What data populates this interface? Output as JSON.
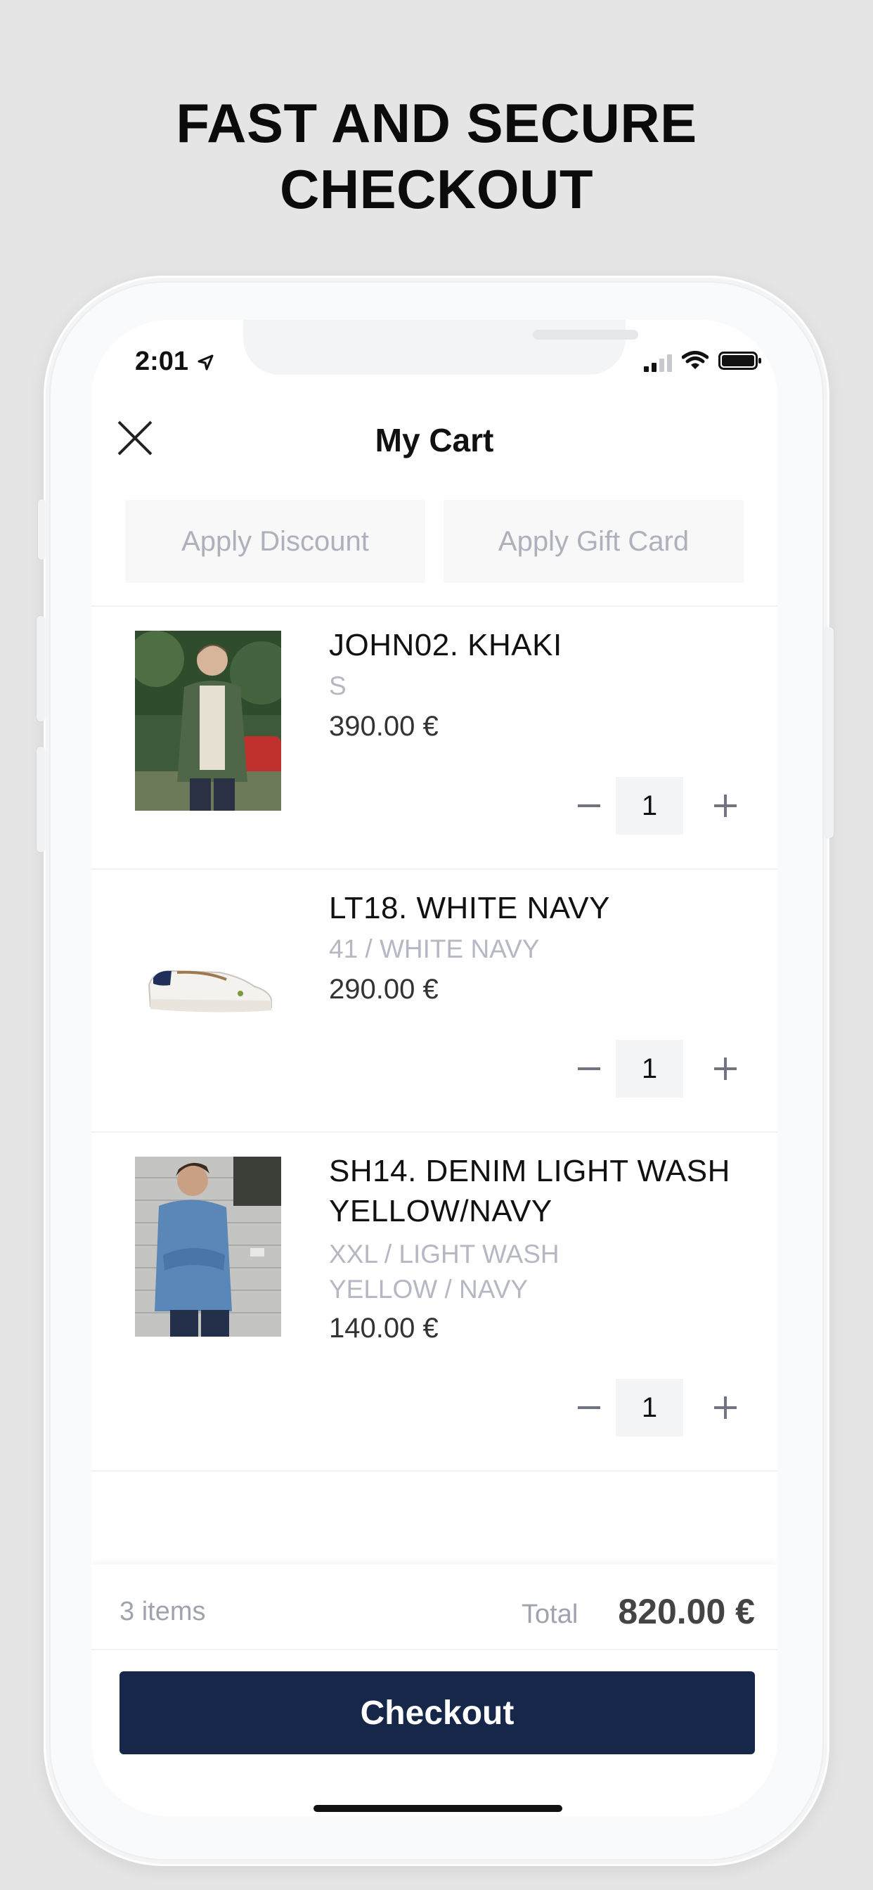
{
  "headline": {
    "line1": "FAST AND SECURE",
    "line2": "CHECKOUT"
  },
  "status_bar": {
    "time": "2:01"
  },
  "nav": {
    "title": "My Cart"
  },
  "promo": {
    "discount_label": "Apply Discount",
    "gift_card_label": "Apply Gift Card"
  },
  "items": [
    {
      "name": "JOHN02.  KHAKI",
      "variant": "S",
      "price": "390.00 €",
      "quantity": "1"
    },
    {
      "name": "LT18. WHITE NAVY",
      "variant": "41 / WHITE NAVY",
      "price": "290.00 €",
      "quantity": "1"
    },
    {
      "name_line1": "SH14. DENIM LIGHT WASH",
      "name_line2": "YELLOW/NAVY",
      "variant_line1": "XXL / LIGHT WASH",
      "variant_line2": "YELLOW / NAVY",
      "price": "140.00 €",
      "quantity": "1"
    }
  ],
  "summary": {
    "items_count": "3 items",
    "total_label": "Total",
    "total_value": "820.00 €"
  },
  "checkout": {
    "label": "Checkout"
  },
  "colors": {
    "checkout_button": "#16274a",
    "muted_text": "#b5b8c3",
    "background": "#e5e5e5"
  }
}
